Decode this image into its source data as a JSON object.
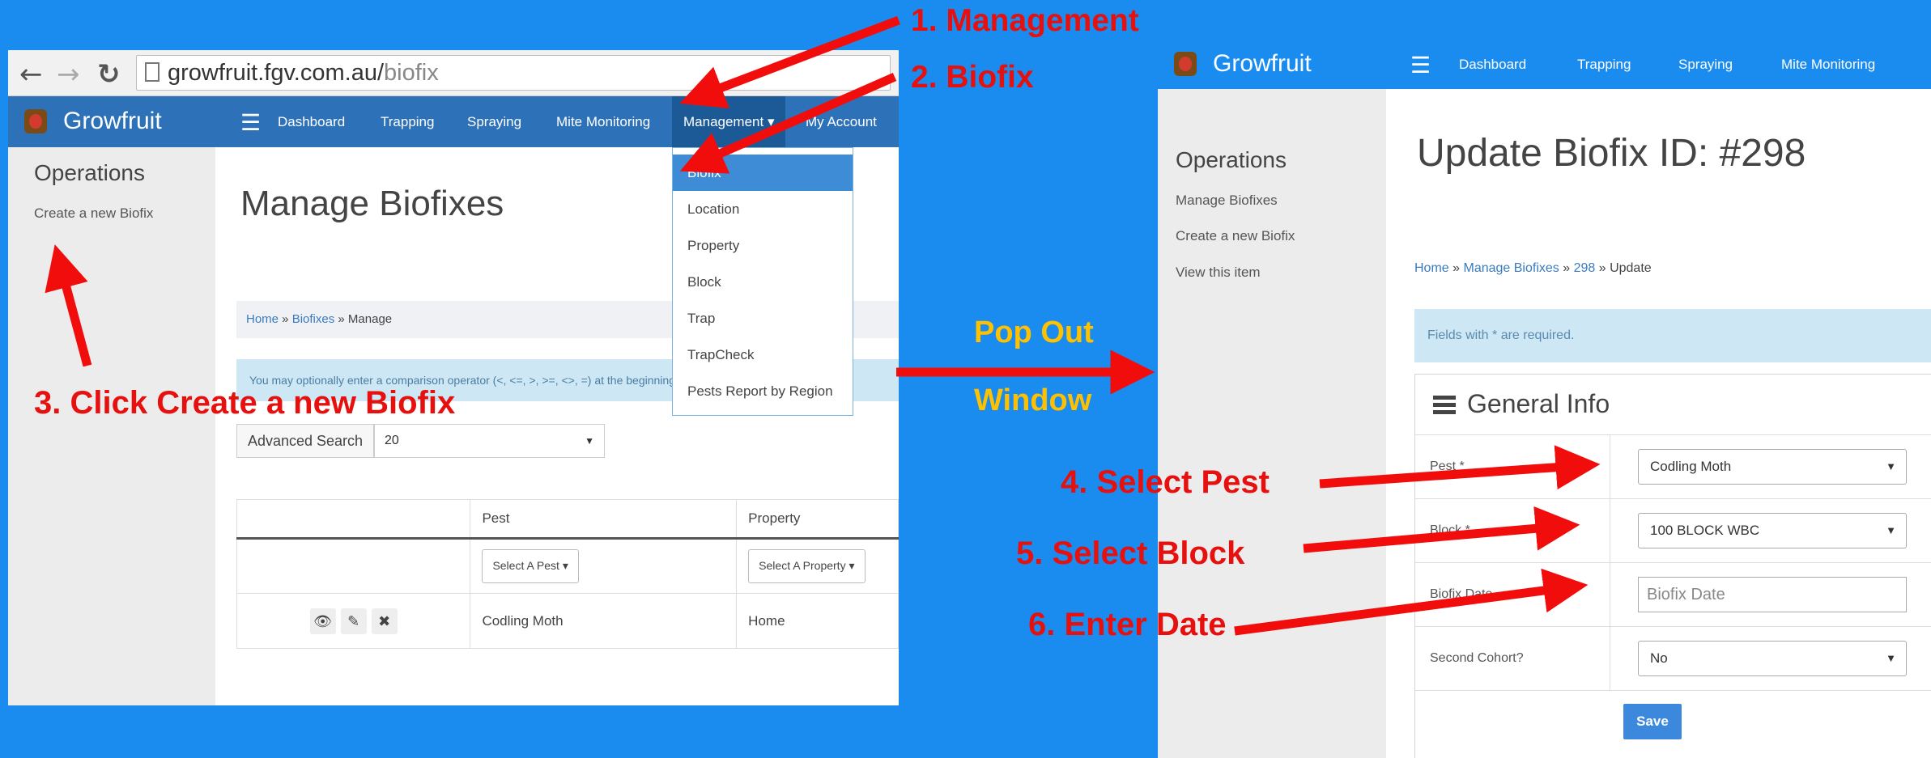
{
  "browser": {
    "url_domain": "growfruit.fgv.com.au/",
    "url_path": "biofix"
  },
  "left": {
    "brand": "Growfruit",
    "nav": [
      "Dashboard",
      "Trapping",
      "Spraying",
      "Mite Monitoring",
      "Management ▾",
      "My Account"
    ],
    "sidebar": {
      "title": "Operations",
      "items": [
        "Create a new Biofix"
      ]
    },
    "title": "Manage Biofixes",
    "breadcrumb": {
      "home": "Home",
      "sep1": " » ",
      "biofixes": "Biofixes",
      "sep2": " » ",
      "current": "Manage"
    },
    "info": "You may optionally enter a comparison operator (<, <=, >, >=, <>, =) at the beginning of each of your se",
    "advanced_search_label": "Advanced Search",
    "page_size": "20",
    "dropdown": [
      "Biofix",
      "Location",
      "Property",
      "Block",
      "Trap",
      "TrapCheck",
      "Pests Report by Region"
    ],
    "table": {
      "headers": [
        "",
        "Pest",
        "Property"
      ],
      "filters": [
        "Select A Pest",
        "Select A Property"
      ],
      "rows": [
        {
          "pest": "Codling Moth",
          "property": "Home"
        }
      ]
    }
  },
  "right": {
    "brand": "Growfruit",
    "nav": [
      "Dashboard",
      "Trapping",
      "Spraying",
      "Mite Monitoring"
    ],
    "sidebar": {
      "title": "Operations",
      "items": [
        "Manage Biofixes",
        "Create a new Biofix",
        "View this item"
      ]
    },
    "title": "Update Biofix ID: #298",
    "breadcrumb": {
      "home": "Home",
      "sep1": " » ",
      "manage": "Manage Biofixes",
      "sep2": " » ",
      "id": "298",
      "sep3": " » ",
      "current": "Update"
    },
    "info": "Fields with * are required.",
    "panel_title": "General Info",
    "fields": {
      "pest": {
        "label": "Pest *",
        "value": "Codling Moth"
      },
      "block": {
        "label": "Block *",
        "value": "100 BLOCK WBC"
      },
      "date": {
        "label": "Biofix Date",
        "placeholder": "Biofix Date"
      },
      "cohort": {
        "label": "Second Cohort?",
        "value": "No"
      }
    },
    "save_label": "Save"
  },
  "annotations": {
    "step1": "1. Management",
    "step2": "2. Biofix",
    "step3": "3. Click Create a new Biofix",
    "popout1": "Pop Out",
    "popout2": "Window",
    "step4": "4. Select Pest",
    "step5": "5. Select Block",
    "step6": "6. Enter Date"
  },
  "colors": {
    "background": "#1a8cef",
    "navbar": "#2d72b8",
    "annotation_red": "#e6100e",
    "annotation_yellow": "#ffc000"
  }
}
